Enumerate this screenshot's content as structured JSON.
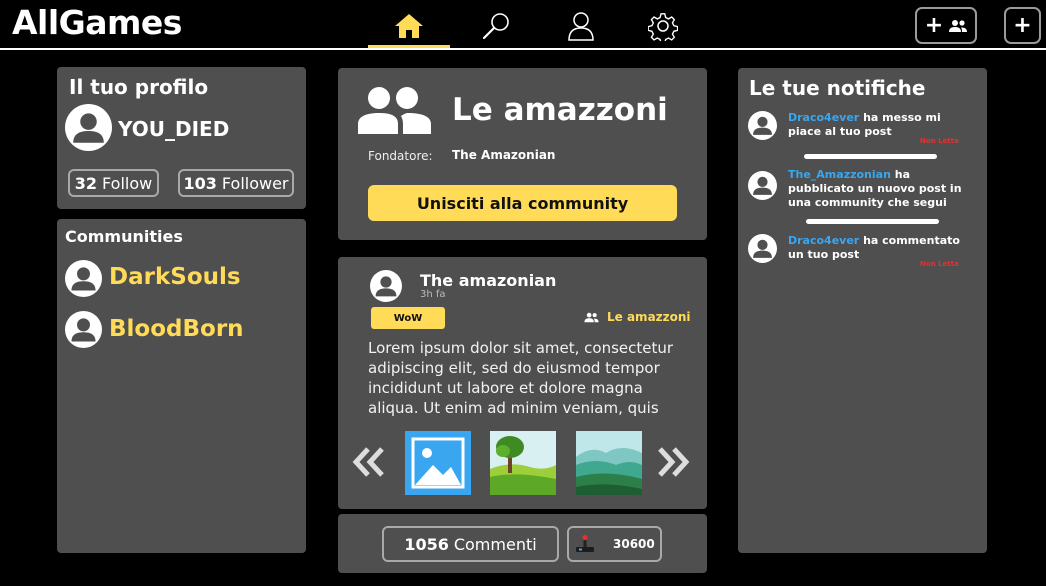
{
  "app": {
    "title": "AllGames"
  },
  "nav": {
    "items": [
      {
        "name": "home-icon",
        "active": true
      },
      {
        "name": "search-icon",
        "active": false
      },
      {
        "name": "user-icon",
        "active": false
      },
      {
        "name": "gear-icon",
        "active": false
      }
    ]
  },
  "top_actions": {
    "add_community": "+",
    "add_post": "+"
  },
  "profile": {
    "title": "Il tuo profilo",
    "username": "YOU_DIED",
    "follow_count": "32",
    "follow_label": "Follow",
    "follower_count": "103",
    "follower_label": "Follower"
  },
  "communities": {
    "title": "Communities",
    "items": [
      {
        "name": "DarkSouls"
      },
      {
        "name": "BloodBorn"
      }
    ]
  },
  "community": {
    "name": "Le amazzoni",
    "founder_label": "Fondatore:",
    "founder_name": "The Amazonian",
    "join_label": "Unisciti alla community"
  },
  "post": {
    "author": "The amazonian",
    "time": "3h fa",
    "tag": "WoW",
    "community": "Le amazzoni",
    "body": "Lorem ipsum dolor sit amet, consectetur adipiscing elit, sed do eiusmod tempor incididunt ut labore et dolore magna aliqua. Ut enim ad minim veniam, quis",
    "comments_count": "1056",
    "comments_label": "Commenti",
    "likes_count": "30600"
  },
  "notifications": {
    "title": "Le tue notifiche",
    "items": [
      {
        "user": "Draco4ever",
        "text": " ha messo mi piace al tuo post",
        "status": "Non Letta"
      },
      {
        "user": "The_Amazzonian",
        "text": " ha pubblicato un nuovo post in una community che segui",
        "status": ""
      },
      {
        "user": "Draco4ever",
        "text": " ha commentato un tuo post",
        "status": "Non Letta"
      }
    ]
  },
  "colors": {
    "accent": "#ffdb58",
    "panel": "#4f4f4f",
    "link": "#3aa6f0",
    "unread": "#e53030"
  }
}
